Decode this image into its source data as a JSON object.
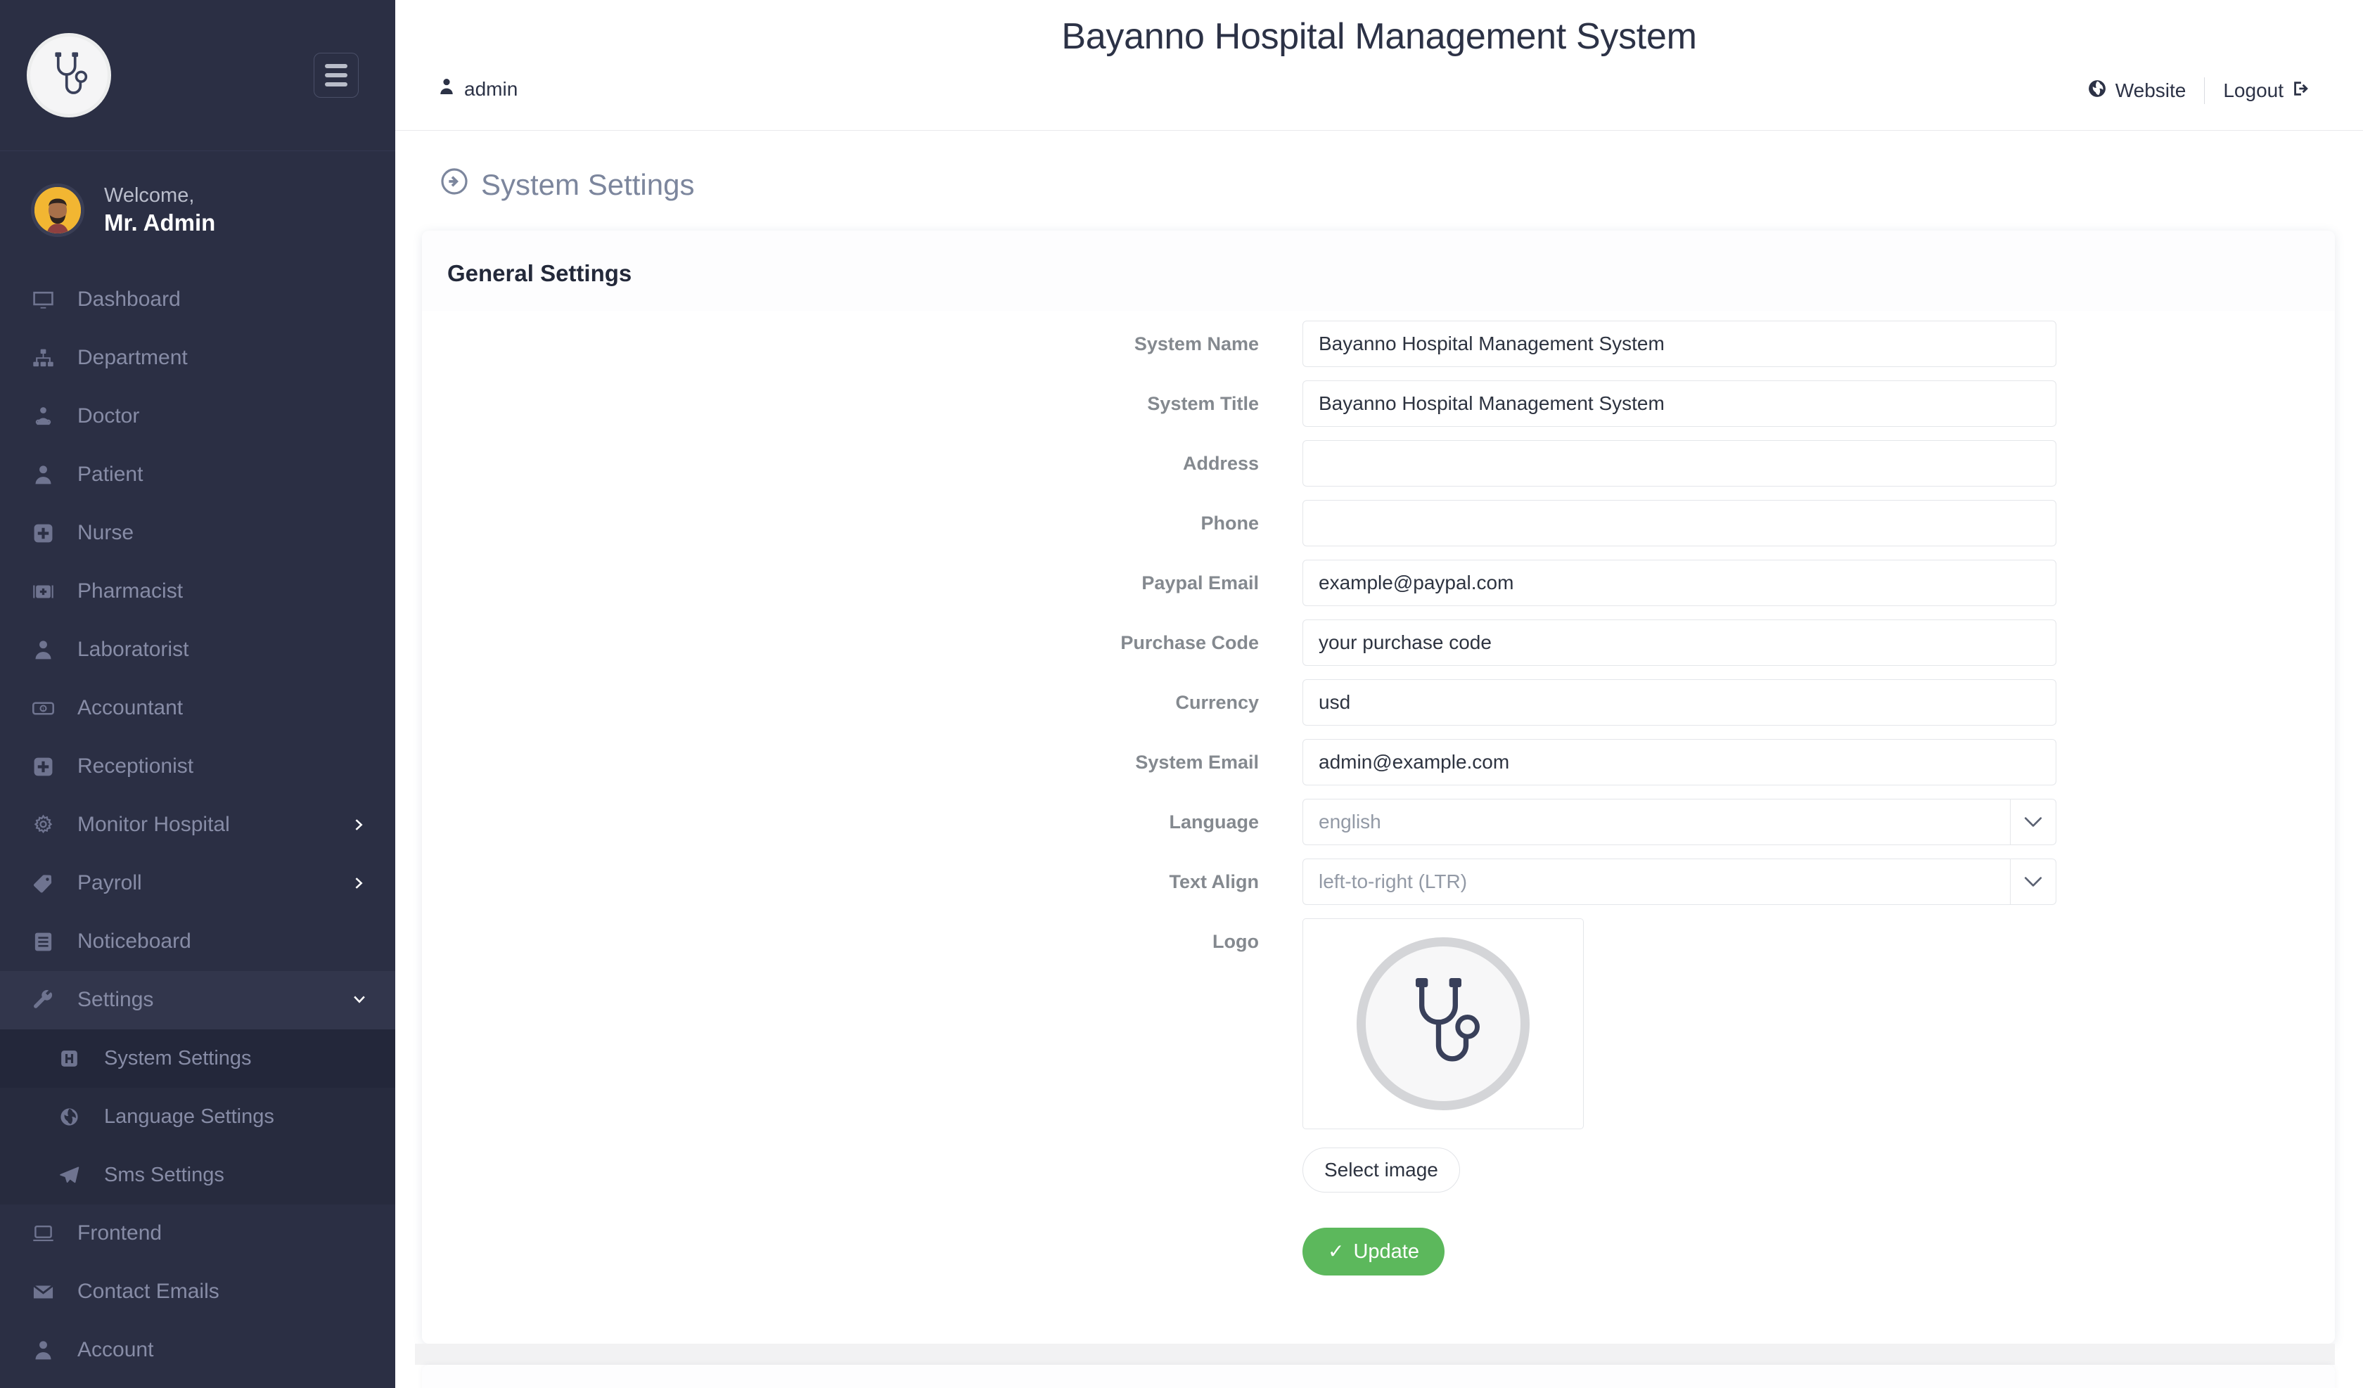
{
  "sidebar": {
    "brand_icon": "stethoscope-logo-icon",
    "toggle_icon": "hamburger-menu-icon",
    "welcome_greeting": "Welcome,",
    "welcome_name": "Mr. Admin",
    "items": [
      {
        "label": "Dashboard",
        "icon": "monitor-icon",
        "caret": null
      },
      {
        "label": "Department",
        "icon": "sitemap-icon",
        "caret": null
      },
      {
        "label": "Doctor",
        "icon": "doctor-icon",
        "caret": null
      },
      {
        "label": "Patient",
        "icon": "user-icon",
        "caret": null
      },
      {
        "label": "Nurse",
        "icon": "plus-square-icon",
        "caret": null
      },
      {
        "label": "Pharmacist",
        "icon": "medical-bag-icon",
        "caret": null
      },
      {
        "label": "Laboratorist",
        "icon": "user-icon",
        "caret": null
      },
      {
        "label": "Accountant",
        "icon": "money-bill-icon",
        "caret": null
      },
      {
        "label": "Receptionist",
        "icon": "plus-square-icon",
        "caret": null
      },
      {
        "label": "Monitor Hospital",
        "icon": "gear-icon",
        "caret": "chevron-right-icon"
      },
      {
        "label": "Payroll",
        "icon": "tag-icon",
        "caret": "chevron-right-icon"
      },
      {
        "label": "Noticeboard",
        "icon": "list-alt-icon",
        "caret": null
      }
    ],
    "settings_group": {
      "label": "Settings",
      "icon": "wrench-icon",
      "caret": "chevron-down-icon",
      "children": [
        {
          "label": "System Settings",
          "icon": "save-icon",
          "active": true
        },
        {
          "label": "Language Settings",
          "icon": "globe-icon",
          "active": false
        },
        {
          "label": "Sms Settings",
          "icon": "paper-plane-icon",
          "active": false
        }
      ]
    },
    "items_after": [
      {
        "label": "Frontend",
        "icon": "laptop-icon"
      },
      {
        "label": "Contact Emails",
        "icon": "envelope-icon"
      },
      {
        "label": "Account",
        "icon": "user-icon"
      }
    ]
  },
  "topbar": {
    "app_title": "Bayanno Hospital Management System",
    "user_label": "admin",
    "user_icon": "user-icon",
    "website_label": "Website",
    "website_icon": "globe-icon",
    "logout_label": "Logout",
    "logout_icon": "sign-out-icon"
  },
  "page": {
    "title": "System Settings",
    "title_icon": "arrow-circle-right-icon",
    "card_title": "General Settings"
  },
  "form": {
    "fields": [
      {
        "label": "System Name",
        "type": "text",
        "value": "Bayanno Hospital Management System",
        "placeholder": "",
        "name": "system-name-input"
      },
      {
        "label": "System Title",
        "type": "text",
        "value": "Bayanno Hospital Management System",
        "placeholder": "",
        "name": "system-title-input"
      },
      {
        "label": "Address",
        "type": "text",
        "value": "",
        "placeholder": "",
        "name": "address-input"
      },
      {
        "label": "Phone",
        "type": "text",
        "value": "",
        "placeholder": "",
        "name": "phone-input"
      },
      {
        "label": "Paypal Email",
        "type": "text",
        "value": "example@paypal.com",
        "placeholder": "",
        "name": "paypal-email-input"
      },
      {
        "label": "Purchase Code",
        "type": "text",
        "value": "your purchase code",
        "placeholder": "",
        "name": "purchase-code-input"
      },
      {
        "label": "Currency",
        "type": "text",
        "value": "usd",
        "placeholder": "",
        "name": "currency-input"
      },
      {
        "label": "System Email",
        "type": "text",
        "value": "admin@example.com",
        "placeholder": "",
        "name": "system-email-input"
      },
      {
        "label": "Language",
        "type": "select",
        "value": "english",
        "name": "language-select"
      },
      {
        "label": "Text Align",
        "type": "select",
        "value": "left-to-right (LTR)",
        "name": "text-align-select"
      }
    ],
    "logo_label": "Logo",
    "logo_icon": "stethoscope-logo-icon",
    "select_image_label": "Select image",
    "update_label": "Update",
    "update_icon": "check-icon"
  },
  "colors": {
    "sidebar_bg": "#2b2f44",
    "sidebar_sub_bg": "#272b3e",
    "sidebar_active_bg": "#23273a",
    "accent_green": "#5cb85c",
    "text_dark": "#2c3246",
    "label_gray": "#84898f",
    "page_title_gray": "#7c869d",
    "avatar_yellow": "#f2b632"
  }
}
